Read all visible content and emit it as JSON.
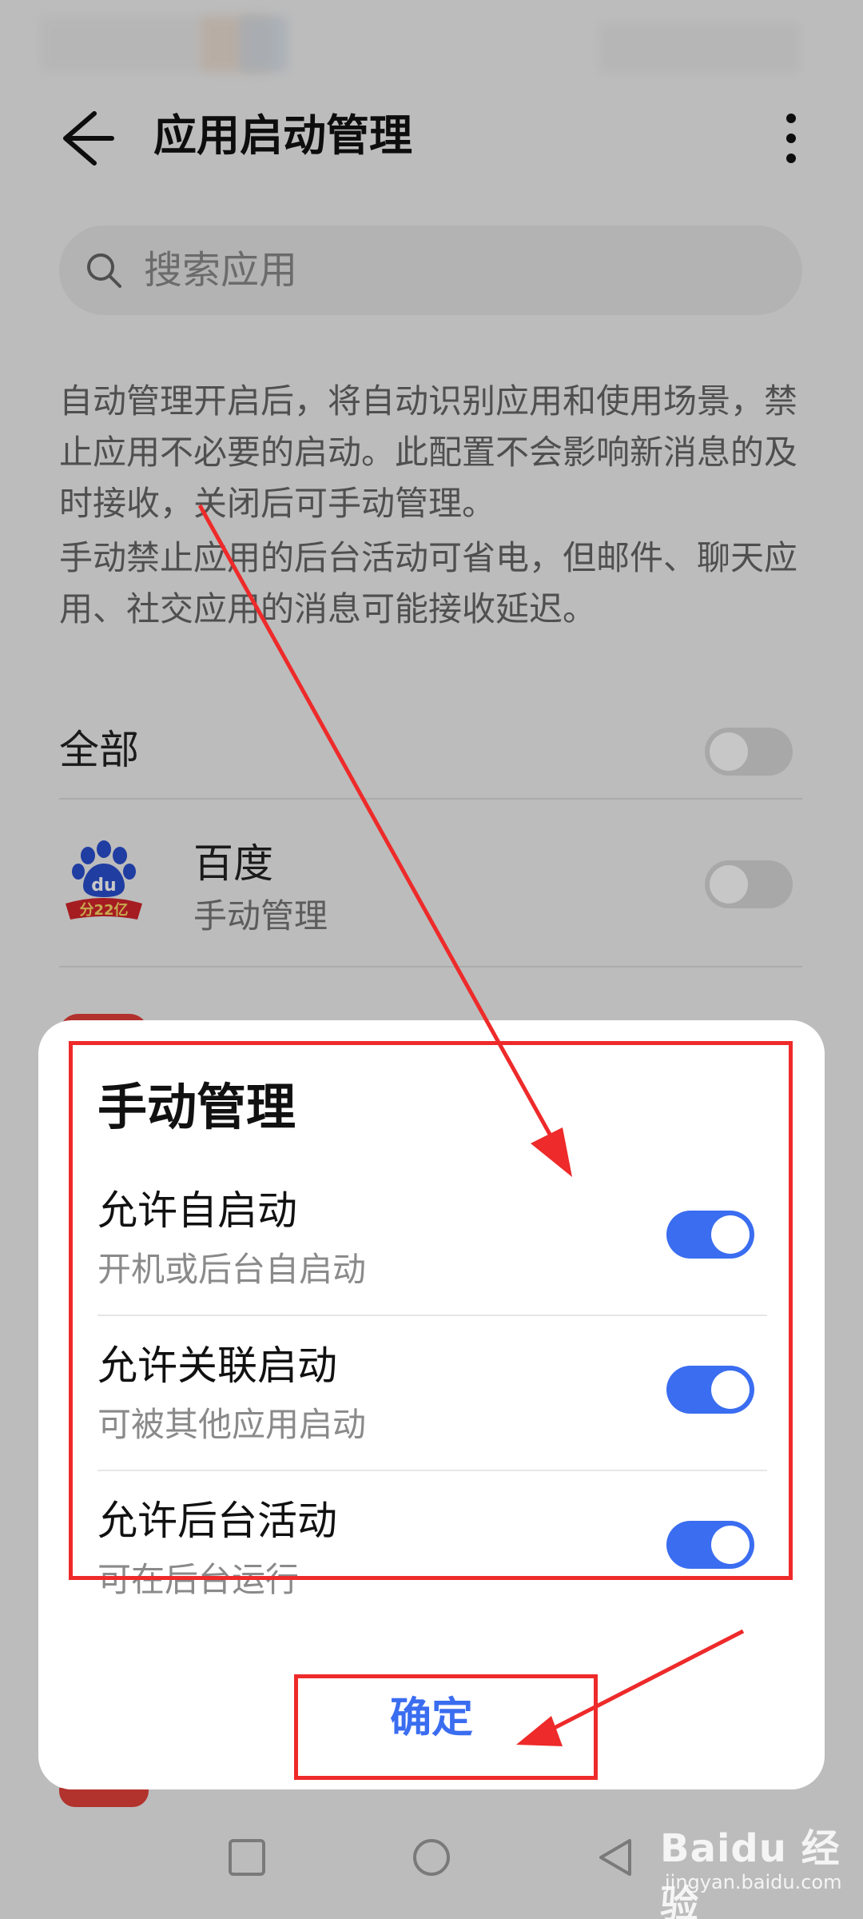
{
  "header": {
    "title": "应用启动管理"
  },
  "search": {
    "placeholder": "搜索应用"
  },
  "description": {
    "line1": "自动管理开启后，将自动识别应用和使用场景，禁止应用不必要的启动。此配置不会影响新消息的及时接收，关闭后可手动管理。",
    "line2": "手动禁止应用的后台活动可省电，但邮件、聊天应用、社交应用的消息可能接收延迟。"
  },
  "all_row": {
    "label": "全部",
    "enabled": false
  },
  "apps": [
    {
      "name": "百度",
      "status": "手动管理",
      "enabled": false,
      "icon": "baidu-app-icon",
      "badge": "分22亿"
    }
  ],
  "dialog": {
    "title": "手动管理",
    "options": [
      {
        "title": "允许自启动",
        "subtitle": "开机或后台自启动",
        "enabled": true
      },
      {
        "title": "允许关联启动",
        "subtitle": "可被其他应用启动",
        "enabled": true
      },
      {
        "title": "允许后台活动",
        "subtitle": "可在后台运行",
        "enabled": true
      }
    ],
    "confirm_label": "确定"
  },
  "watermark": {
    "main": "Baidu 经验",
    "sub": "jingyan.baidu.com"
  },
  "colors": {
    "accent": "#3a6df0",
    "annotation": "#ee2a2a"
  }
}
